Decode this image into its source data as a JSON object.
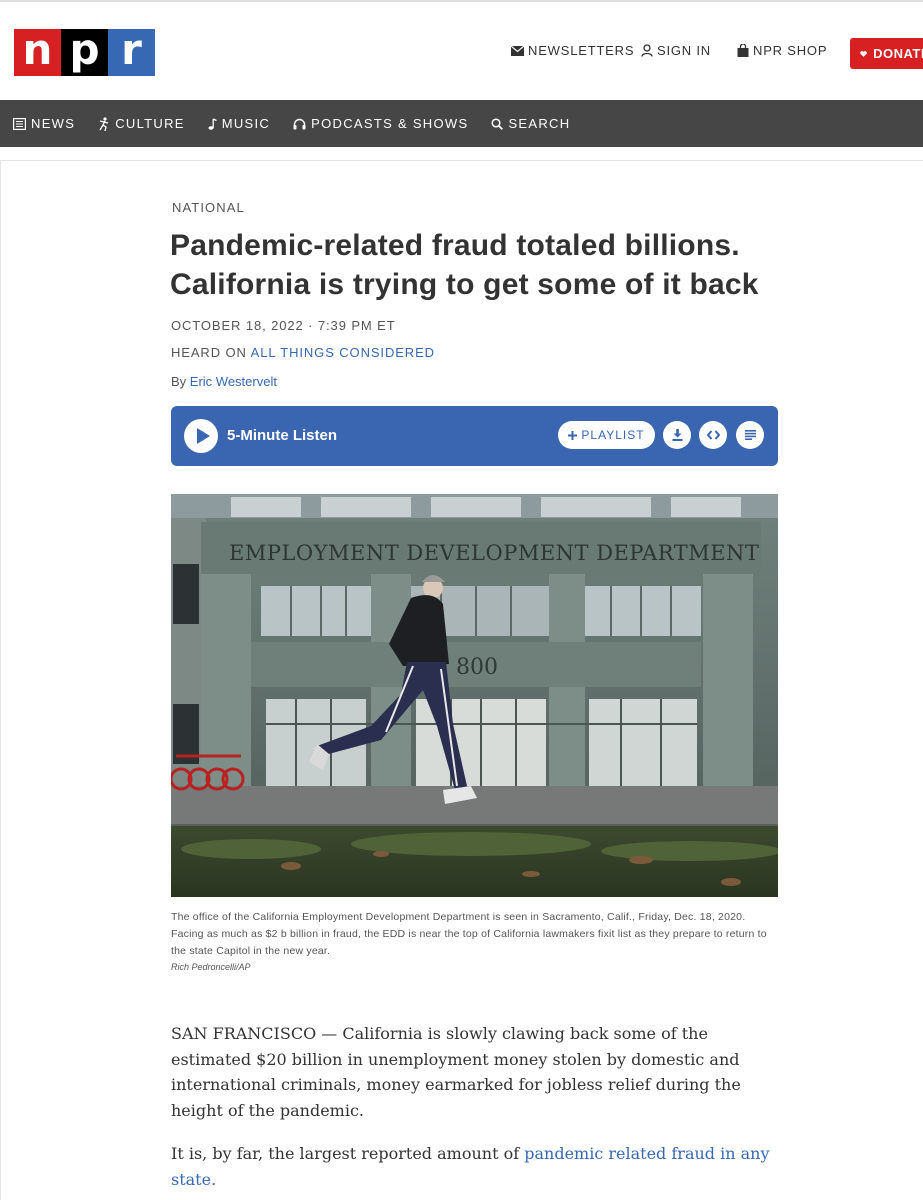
{
  "logo": {
    "letters": [
      "n",
      "p",
      "r"
    ]
  },
  "utility_nav": {
    "newsletters": "NEWSLETTERS",
    "sign_in": "SIGN IN",
    "shop": "NPR SHOP",
    "donate": "DONATE"
  },
  "main_nav": [
    {
      "label": "NEWS",
      "icon": "news-icon"
    },
    {
      "label": "CULTURE",
      "icon": "culture-icon"
    },
    {
      "label": "MUSIC",
      "icon": "music-icon"
    },
    {
      "label": "PODCASTS & SHOWS",
      "icon": "headphones-icon"
    },
    {
      "label": "SEARCH",
      "icon": "search-icon"
    }
  ],
  "article": {
    "slug": "NATIONAL",
    "headline": "Pandemic-related fraud totaled billions. California is trying to get some of it back",
    "dateline": "OCTOBER 18, 2022 · 7:39 PM ET",
    "heard_on_prefix": "HEARD ON",
    "heard_on_show": "ALL THINGS CONSIDERED",
    "byline_prefix": "By",
    "author": "Eric Westervelt"
  },
  "player": {
    "listen_label": "5-Minute Listen",
    "playlist_label": "PLAYLIST",
    "accent": "#3a65b1"
  },
  "photo": {
    "sign_text": "EMPLOYMENT DEVELOPMENT DEPARTMENT",
    "building_number": "800",
    "caption": "The office of the California Employment Development Department is seen in Sacramento, Calif., Friday, Dec. 18, 2020. Facing as much as $2 b billion in fraud, the EDD is near the top of California lawmakers fixit list as they prepare to return to the state Capitol in the new year.",
    "credit": "Rich Pedroncelli/AP"
  },
  "body": {
    "para1": "SAN FRANCISCO — California is slowly clawing back some of the estimated $20 billion in unemployment money stolen by domestic and international criminals, money earmarked for jobless relief during the height of the pandemic.",
    "para2_text": "It is, by far, the largest reported amount of",
    "para2_link": "pandemic related fraud in any state."
  },
  "colors": {
    "brand_red": "#d62021",
    "brand_blue": "#3768b4",
    "nav_bg": "#464646"
  }
}
